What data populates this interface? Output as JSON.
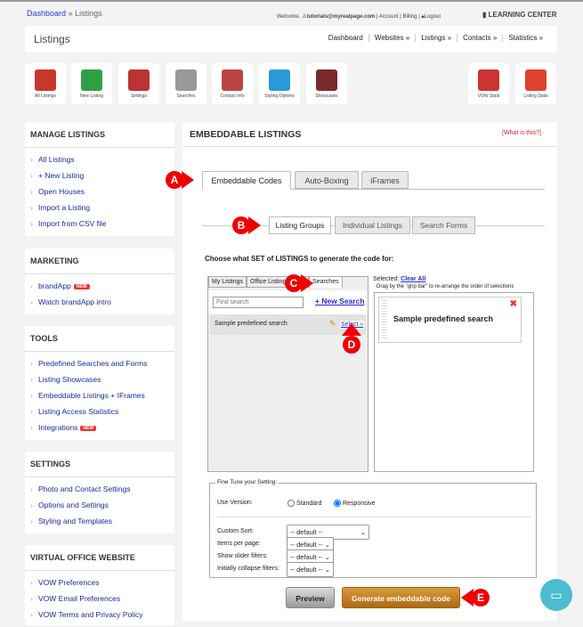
{
  "breadcrumb": {
    "root": "Dashboard",
    "sep": "»",
    "current": "Listings"
  },
  "topbar": {
    "welcome": "Welcome,",
    "email": "tutorials@myrealpage.com",
    "account": "Account",
    "billing": "Billing",
    "logout": "Logout",
    "learning": "LEARNING CENTER"
  },
  "header": {
    "title": "Listings",
    "nav": [
      "Dashboard",
      "Websites »",
      "Listings »",
      "Contacts »",
      "Statistics »"
    ]
  },
  "tiles": [
    {
      "label": "All Listings",
      "color": "#c8372d"
    },
    {
      "label": "New Listing",
      "color": "#2ea043"
    },
    {
      "label": "Settings",
      "color": "#b33"
    },
    {
      "label": "Searches",
      "color": "#999"
    },
    {
      "label": "Contact Info",
      "color": "#b44"
    },
    {
      "label": "Styling Options",
      "color": "#2a9ad8"
    },
    {
      "label": "Showcases",
      "color": "#7a2a2a"
    },
    {
      "label": "VOW Stats",
      "color": "#c33"
    },
    {
      "label": "Listing Stats",
      "color": "#e04030"
    }
  ],
  "sidebar": [
    {
      "title": "MANAGE LISTINGS",
      "items": [
        {
          "label": "All Listings"
        },
        {
          "label": "+ New Listing"
        },
        {
          "label": "Open Houses"
        },
        {
          "label": "Import a Listing"
        },
        {
          "label": "Import from CSV file"
        }
      ]
    },
    {
      "title": "MARKETING",
      "items": [
        {
          "label": "brandApp",
          "badge": "NEW"
        },
        {
          "label": "Watch brandApp intro"
        }
      ]
    },
    {
      "title": "TOOLS",
      "items": [
        {
          "label": "Predefined Searches and Forms"
        },
        {
          "label": "Listing Showcases"
        },
        {
          "label": "Embeddable Listings + IFrames"
        },
        {
          "label": "Listing Access Statistics"
        },
        {
          "label": "Integrations",
          "badge": "NEW"
        }
      ]
    },
    {
      "title": "SETTINGS",
      "items": [
        {
          "label": "Photo and Contact Settings"
        },
        {
          "label": "Options and Settings"
        },
        {
          "label": "Styling and Templates"
        }
      ]
    },
    {
      "title": "VIRTUAL OFFICE WEBSITE",
      "items": [
        {
          "label": "VOW Preferences"
        },
        {
          "label": "VOW Email Preferences"
        },
        {
          "label": "VOW Terms and Privacy Policy"
        }
      ]
    }
  ],
  "main": {
    "title": "EMBEDDABLE LISTINGS",
    "help": "[What is this?]",
    "tabs": [
      "Embeddable Codes",
      "Auto-Boxing",
      "iFrames"
    ],
    "subtabs": [
      "Listing Groups",
      "Individual Listings",
      "Search Forms"
    ],
    "choose": "Choose what SET of LISTINGS to generate the code for:",
    "settabs": [
      "My Listings",
      "Office Listings",
      "Searches"
    ],
    "search_placeholder": "Find search",
    "new_search": "+ New Search",
    "row": {
      "name": "Sample predefined search",
      "select": "Select »"
    },
    "selected_label": "Selected:",
    "clear_all": "Clear All",
    "drag_hint": "Drag by the \"grip bar\" to re-arrange the order of selections",
    "selected_item": "Sample predefined search",
    "fine": {
      "legend": "Fine Tune your Setting:",
      "version_label": "Use Version:",
      "standard": "Standard",
      "responsive": "Responsive",
      "version": "Responsive",
      "fields": [
        {
          "label": "Custom Sort:",
          "value": "-- default --"
        },
        {
          "label": "Items per page:",
          "value": "-- default --"
        },
        {
          "label": "Show slider filters:",
          "value": "-- default --"
        },
        {
          "label": "Initially collapse filters:",
          "value": "-- default --"
        }
      ]
    },
    "preview": "Preview",
    "generate": "Generate embeddable code"
  },
  "markers": [
    "A",
    "B",
    "C",
    "D",
    "E"
  ]
}
